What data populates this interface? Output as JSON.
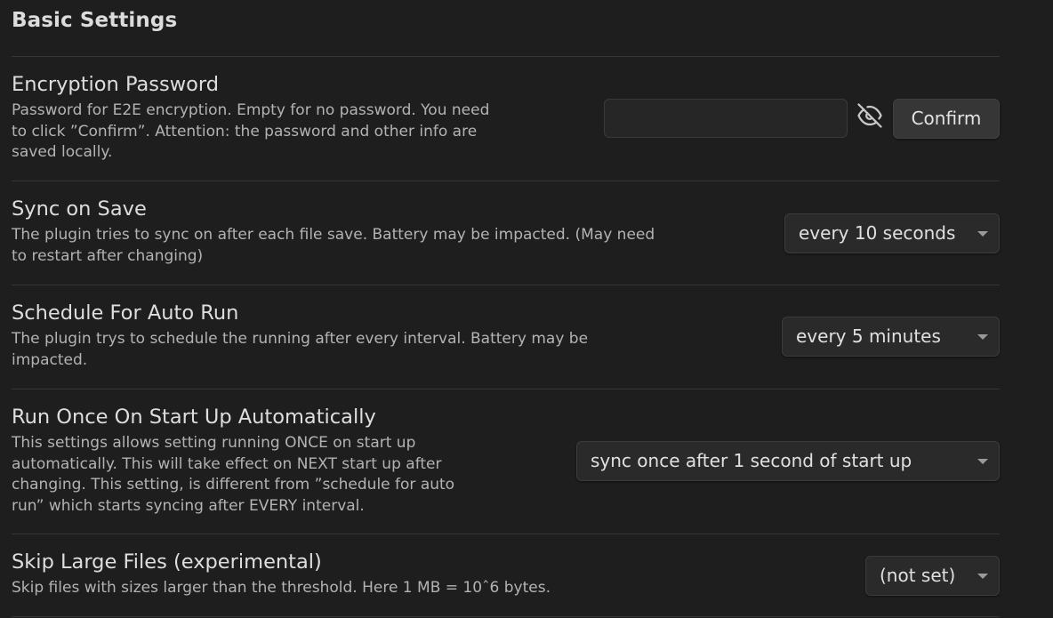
{
  "section": {
    "title": "Basic Settings"
  },
  "settings": [
    {
      "name": "Encryption Password",
      "desc_lines": [
        "Password for E2E encryption. Empty for no password. You need",
        "to click ”Confirm”. Attention: the password and other info are",
        "saved locally."
      ],
      "input_value": "",
      "confirm_label": "Confirm",
      "toggle_icon": "eye-off-icon"
    },
    {
      "name": "Sync on Save",
      "desc_lines": [
        "The plugin tries to sync on after each file save. Battery may be impacted. (May need",
        "to restart after changing)"
      ],
      "selected": "every 10 seconds"
    },
    {
      "name": "Schedule For Auto Run",
      "desc_lines": [
        "The plugin trys to schedule the running after every interval. Battery may be",
        "impacted."
      ],
      "selected": "every 5 minutes"
    },
    {
      "name": "Run Once On Start Up Automatically",
      "desc_lines": [
        "This settings allows setting running ONCE on start up",
        "automatically. This will take effect on NEXT start up after",
        "changing. This setting, is different from ”schedule for auto",
        "run” which starts syncing after EVERY interval."
      ],
      "selected": "sync once after 1 second of start up"
    },
    {
      "name": "Skip Large Files (experimental)",
      "desc_lines": [
        "Skip files with sizes larger than the threshold. Here 1 MB = 10ˆ6 bytes."
      ],
      "selected": "(not set)"
    }
  ],
  "colors": {
    "background": "#1e1e1e",
    "text": "#dedede",
    "muted": "#b3b3b3",
    "divider": "#363636"
  }
}
